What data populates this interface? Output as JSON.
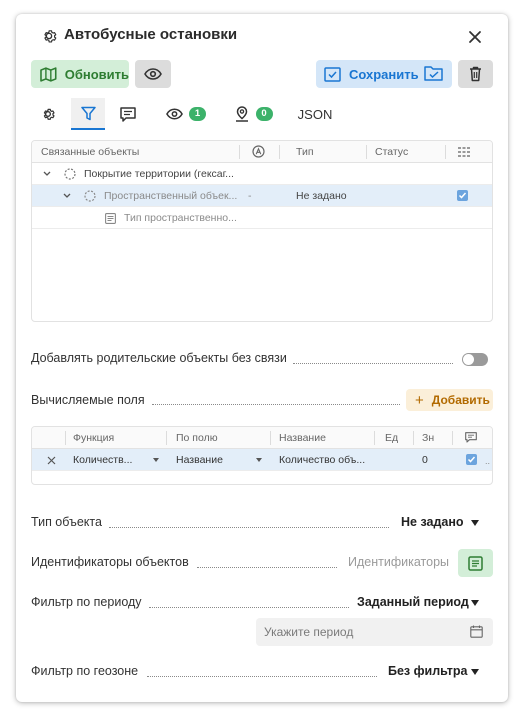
{
  "window": {
    "title": "Автобусные остановки"
  },
  "toolbar": {
    "refresh_label": "Обновить",
    "save_label": "Сохранить"
  },
  "tabs": {
    "visible_count": "1",
    "location_count": "0",
    "json_label": "JSON",
    "active": "filter"
  },
  "related_table": {
    "headers": [
      "Связанные объекты",
      "Тип",
      "Статус"
    ],
    "rows": [
      {
        "name": "Покрытие территории (гексаг...",
        "type": "",
        "status": ""
      },
      {
        "name": "Пространственный объек...",
        "mark": "-",
        "type": "Не задано",
        "checked": true
      },
      {
        "name": "Тип пространственно...",
        "type": ""
      }
    ]
  },
  "parent_toggle": {
    "label": "Добавлять родительские объекты без связи",
    "on": false
  },
  "calc_fields": {
    "label": "Вычисляемые поля",
    "add_label": "Добавить",
    "headers": [
      "Функция",
      "По полю",
      "Название",
      "Ед",
      "Зн"
    ],
    "rows": [
      {
        "function": "Количеств...",
        "field": "Название",
        "name": "Количество объ...",
        "unit": "",
        "value": "0",
        "checked": true
      }
    ]
  },
  "object_type": {
    "label": "Тип объекта",
    "value": "Не задано"
  },
  "object_ids": {
    "label": "Идентификаторы объектов",
    "placeholder": "Идентификаторы"
  },
  "period_filter": {
    "label": "Фильтр по периоду",
    "value": "Заданный период",
    "input_placeholder": "Укажите период"
  },
  "geozone_filter": {
    "label": "Фильтр по геозоне",
    "value": "Без фильтра"
  },
  "colors": {
    "accent_blue": "#1976d2",
    "green": "#2e7d32",
    "badge_green": "#3cb26a",
    "add_orange": "#b26a00"
  }
}
